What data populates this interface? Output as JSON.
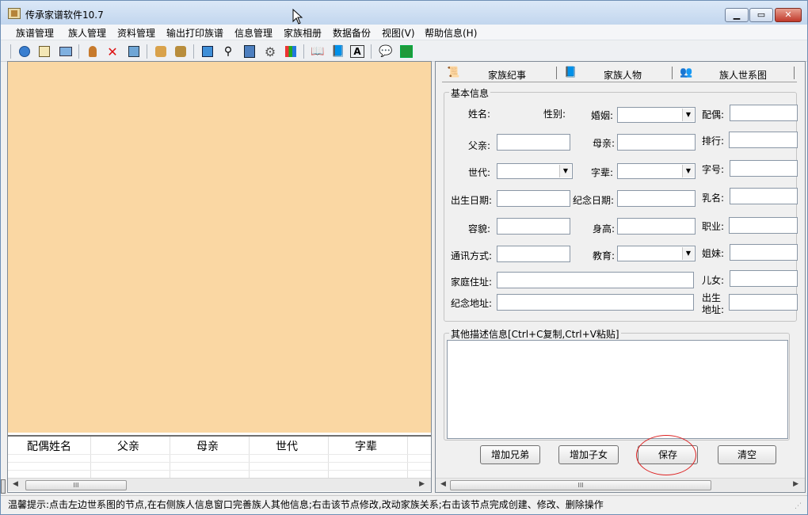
{
  "window": {
    "title": "传承家谱软件10.7"
  },
  "menu": [
    "族谱管理",
    "族人管理",
    "资料管理",
    "输出打印族谱",
    "信息管理",
    "家族相册",
    "数据备份",
    "视图(V)",
    "帮助信息(H)"
  ],
  "toolbar": {
    "icons": [
      "globe-icon",
      "book-icon",
      "screen-icon",
      "add-person-icon",
      "delete-icon",
      "photo-icon",
      "group-icon",
      "family-icon",
      "windows-icon",
      "search-binoculars-icon",
      "database-icon",
      "gear-icon",
      "chart-icon",
      "open-book-icon",
      "closed-book-icon",
      "text-icon",
      "help-icon",
      "exit-icon"
    ]
  },
  "grid": {
    "columns": [
      "配偶姓名",
      "父亲",
      "母亲",
      "世代",
      "字辈"
    ]
  },
  "tabs": [
    "家族纪事",
    "家族人物",
    "族人世系图"
  ],
  "basic_info": {
    "title": "基本信息",
    "labels": {
      "name": "姓名:",
      "gender": "性别:",
      "marriage": "婚姻:",
      "spouse": "配偶:",
      "father": "父亲:",
      "mother": "母亲:",
      "rank": "排行:",
      "generation": "世代:",
      "zibei": "字辈:",
      "courtesy_name": "字号:",
      "birth_date": "出生日期:",
      "memorial_date": "纪念日期:",
      "nickname": "乳名:",
      "appearance": "容貌:",
      "height": "身高:",
      "occupation": "职业:",
      "contact": "通讯方式:",
      "education": "教育:",
      "sisters": "姐妹:",
      "home_address": "家庭住址:",
      "children": "儿女:",
      "memorial_address": "纪念地址:",
      "birthplace_line1": "出生",
      "birthplace_line2": "地址:"
    }
  },
  "other_info": {
    "title": "其他描述信息[Ctrl+C复制,Ctrl+V粘贴]"
  },
  "buttons": {
    "add_sibling": "增加兄弟",
    "add_child": "增加子女",
    "save": "保存",
    "clear": "清空"
  },
  "status": {
    "text": "温馨提示:点击左边世系图的节点,在右侧族人信息窗口完善族人其他信息;右击该节点修改,改动家族关系;右击该节点完成创建、修改、删除操作"
  },
  "colors": {
    "tree_background": "#fad7a3",
    "highlight": "#dd2222"
  }
}
